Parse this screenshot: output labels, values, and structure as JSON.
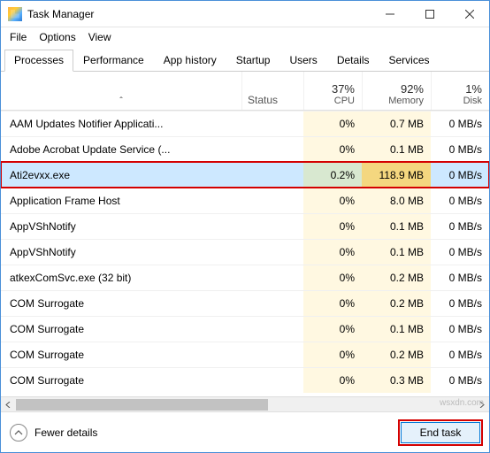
{
  "window": {
    "title": "Task Manager"
  },
  "menu": {
    "file": "File",
    "options": "Options",
    "view": "View"
  },
  "tabs": {
    "processes": "Processes",
    "performance": "Performance",
    "app_history": "App history",
    "startup": "Startup",
    "users": "Users",
    "details": "Details",
    "services": "Services"
  },
  "columns": {
    "name_sort": "ˆ",
    "status": "Status",
    "cpu_pct": "37%",
    "cpu_lbl": "CPU",
    "mem_pct": "92%",
    "mem_lbl": "Memory",
    "disk_pct": "1%",
    "disk_lbl": "Disk"
  },
  "rows": [
    {
      "name": "AAM Updates Notifier Applicati...",
      "cpu": "0%",
      "mem": "0.7 MB",
      "disk": "0 MB/s"
    },
    {
      "name": "Adobe Acrobat Update Service (...",
      "cpu": "0%",
      "mem": "0.1 MB",
      "disk": "0 MB/s"
    },
    {
      "name": "Ati2evxx.exe",
      "cpu": "0.2%",
      "mem": "118.9 MB",
      "disk": "0 MB/s"
    },
    {
      "name": "Application Frame Host",
      "cpu": "0%",
      "mem": "8.0 MB",
      "disk": "0 MB/s"
    },
    {
      "name": "AppVShNotify",
      "cpu": "0%",
      "mem": "0.1 MB",
      "disk": "0 MB/s"
    },
    {
      "name": "AppVShNotify",
      "cpu": "0%",
      "mem": "0.1 MB",
      "disk": "0 MB/s"
    },
    {
      "name": "atkexComSvc.exe (32 bit)",
      "cpu": "0%",
      "mem": "0.2 MB",
      "disk": "0 MB/s"
    },
    {
      "name": "COM Surrogate",
      "cpu": "0%",
      "mem": "0.2 MB",
      "disk": "0 MB/s"
    },
    {
      "name": "COM Surrogate",
      "cpu": "0%",
      "mem": "0.1 MB",
      "disk": "0 MB/s"
    },
    {
      "name": "COM Surrogate",
      "cpu": "0%",
      "mem": "0.2 MB",
      "disk": "0 MB/s"
    },
    {
      "name": "COM Surrogate",
      "cpu": "0%",
      "mem": "0.3 MB",
      "disk": "0 MB/s"
    }
  ],
  "selected_index": 2,
  "footer": {
    "fewer_details": "Fewer details",
    "end_task": "End task"
  },
  "watermark": "wsxdn.com"
}
